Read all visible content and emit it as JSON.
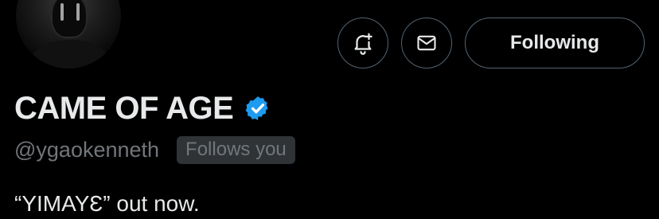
{
  "profile": {
    "display_name": "CAME OF AGE",
    "handle": "@ygaokenneth",
    "follows_you": "Follows you",
    "bio": "“YIMAYƐ” out now.",
    "verified": true
  },
  "actions": {
    "notifications_icon": "bell-plus-icon",
    "message_icon": "envelope-icon",
    "following_label": "Following"
  },
  "colors": {
    "background": "#000000",
    "primary_text": "#e7e9ea",
    "secondary_text": "#71767b",
    "border": "#536471",
    "badge_bg": "#2f3336",
    "verified_blue": "#1d9bf0"
  }
}
